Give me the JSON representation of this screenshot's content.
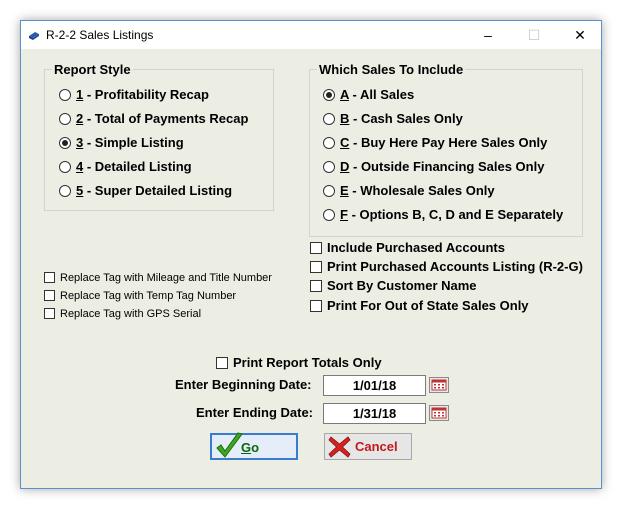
{
  "window": {
    "title": "R-2-2  Sales Listings",
    "controls": {
      "minimize": "–",
      "maximize": "☐",
      "close": "✕"
    }
  },
  "report_style": {
    "title": "Report Style",
    "options": [
      {
        "key": "1",
        "text": " - Profitability Recap",
        "selected": false
      },
      {
        "key": "2",
        "text": " - Total of Payments Recap",
        "selected": false
      },
      {
        "key": "3",
        "text": " - Simple Listing",
        "selected": true
      },
      {
        "key": "4",
        "text": " - Detailed Listing",
        "selected": false
      },
      {
        "key": "5",
        "text": " - Super Detailed Listing",
        "selected": false
      }
    ]
  },
  "which_sales": {
    "title": "Which Sales To Include",
    "options": [
      {
        "key": "A",
        "text": " - All Sales",
        "selected": true
      },
      {
        "key": "B",
        "text": " - Cash Sales Only",
        "selected": false
      },
      {
        "key": "C",
        "text": " - Buy Here Pay Here Sales Only",
        "selected": false
      },
      {
        "key": "D",
        "text": " - Outside Financing Sales Only",
        "selected": false
      },
      {
        "key": "E",
        "text": " - Wholesale Sales Only",
        "selected": false
      },
      {
        "key": "F",
        "text": " - Options B, C, D and E Separately",
        "selected": false
      }
    ]
  },
  "right_checks": [
    {
      "label": "Include Purchased Accounts",
      "checked": false
    },
    {
      "label": "Print Purchased Accounts Listing (R-2-G)",
      "checked": false
    },
    {
      "label": "Sort By Customer Name",
      "checked": false
    },
    {
      "label": "Print For Out of State Sales Only",
      "checked": false
    }
  ],
  "tag_checks": [
    {
      "label": "Replace Tag with Mileage and Title Number",
      "checked": false
    },
    {
      "label": "Replace Tag with Temp Tag Number",
      "checked": false
    },
    {
      "label": "Replace Tag with GPS Serial",
      "checked": false
    }
  ],
  "totals_only": {
    "label": "Print Report Totals Only",
    "checked": false
  },
  "begin_date": {
    "label": "Enter Beginning Date:",
    "value": "1/01/18"
  },
  "end_date": {
    "label": "Enter Ending Date:",
    "value": "1/31/18"
  },
  "buttons": {
    "go": {
      "key": "G",
      "rest": "o"
    },
    "cancel": {
      "label": "Cancel"
    }
  },
  "colors": {
    "dialog_bg": "#eceee4",
    "go_text": "#0a6410",
    "cancel_text": "#c21a1a",
    "focus_border": "#3a7bd0"
  },
  "icons": {
    "app": "app-icon",
    "calendar": "calendar-icon",
    "go": "checkmark-icon",
    "cancel": "x-icon"
  }
}
